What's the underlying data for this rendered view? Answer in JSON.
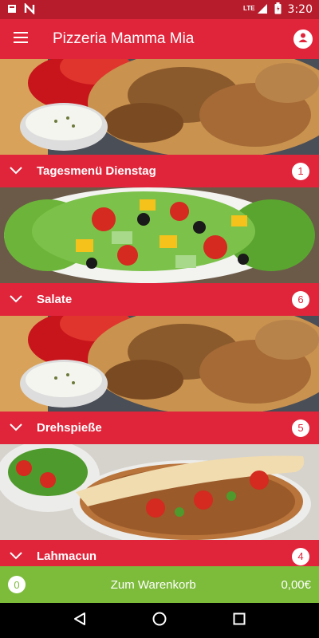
{
  "status": {
    "time": "3:20",
    "network": "LTE"
  },
  "app": {
    "title": "Pizzeria Mamma Mia"
  },
  "categories": [
    {
      "name": "Tagesmenü Dienstag",
      "count": "1",
      "image": "doner-plate"
    },
    {
      "name": "Salate",
      "count": "6",
      "image": "salad"
    },
    {
      "name": "Drehspieße",
      "count": "5",
      "image": "doner-plate"
    },
    {
      "name": "Lahmacun",
      "count": "4",
      "image": "lahmacun"
    }
  ],
  "cart": {
    "count": "0",
    "label": "Zum Warenkorb",
    "total": "0,00€"
  },
  "colors": {
    "primary": "#e0253b",
    "statusbar": "#b71c2c",
    "cart": "#7dbb3b"
  }
}
